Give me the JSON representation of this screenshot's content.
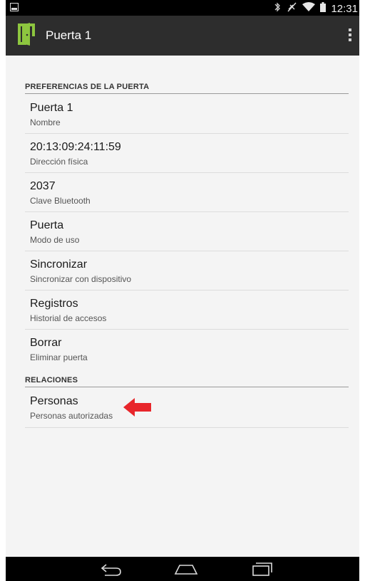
{
  "status_bar": {
    "time": "12:31",
    "icons": [
      "image-notification-icon",
      "bluetooth-icon",
      "mute-icon",
      "wifi-icon",
      "battery-icon"
    ]
  },
  "action_bar": {
    "title": "Puerta 1",
    "app_icon": "door-icon",
    "menu_icon": "overflow-menu-icon"
  },
  "sections": [
    {
      "header": "PREFERENCIAS DE LA PUERTA",
      "items": [
        {
          "title": "Puerta 1",
          "summary": "Nombre"
        },
        {
          "title": "20:13:09:24:11:59",
          "summary": "Dirección física"
        },
        {
          "title": "2037",
          "summary": "Clave Bluetooth"
        },
        {
          "title": "Puerta",
          "summary": "Modo de uso"
        },
        {
          "title": "Sincronizar",
          "summary": "Sincronizar con dispositivo"
        },
        {
          "title": "Registros",
          "summary": "Historial de accesos"
        },
        {
          "title": "Borrar",
          "summary": "Eliminar puerta"
        }
      ]
    },
    {
      "header": "RELACIONES",
      "items": [
        {
          "title": "Personas",
          "summary": "Personas autorizadas"
        }
      ]
    }
  ],
  "annotation": {
    "icon": "red-arrow-left-icon",
    "color": "#e8262b"
  },
  "nav_bar": {
    "icons": [
      "back-icon",
      "home-icon",
      "recents-icon"
    ]
  },
  "colors": {
    "app_icon": "#8dc63f",
    "action_bar": "#2d2d2d",
    "content_bg": "#f4f4f4"
  }
}
